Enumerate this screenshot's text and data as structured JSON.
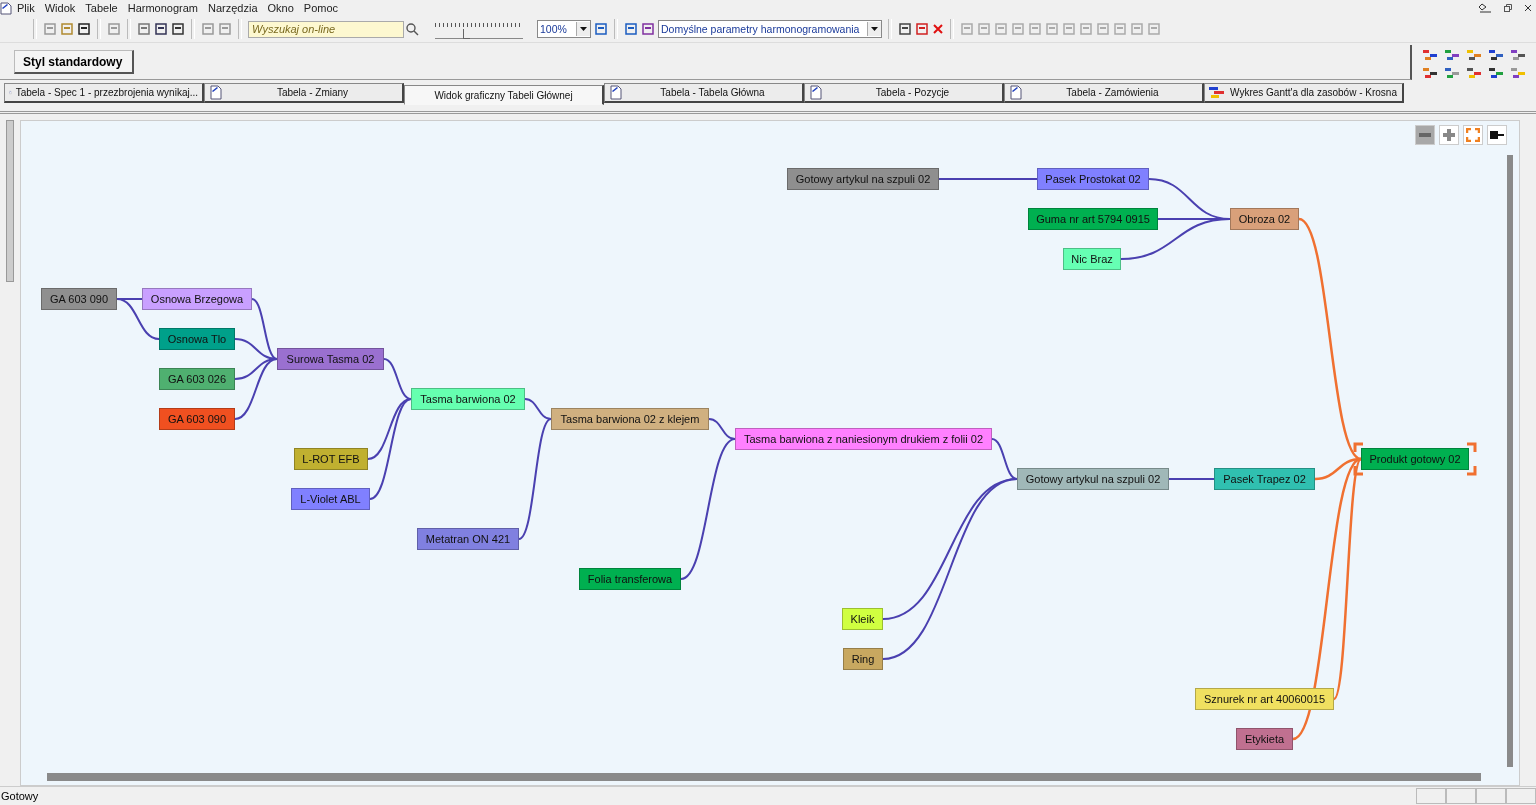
{
  "menu": [
    "Plik",
    "Widok",
    "Tabele",
    "Harmonogram",
    "Narzędzia",
    "Okno",
    "Pomoc"
  ],
  "toolbar": {
    "search": {
      "placeholder": "Wyszukaj on-line"
    },
    "zoom_slider": {
      "level": 0.35
    },
    "zoom": "100%",
    "schedule_params": "Domyślne parametry harmonogramowania"
  },
  "style_button": "Styl standardowy",
  "tabs": [
    {
      "label": "Tabela - Spec 1 - przezbrojenia wynikaj...",
      "kind": "table",
      "selected": false
    },
    {
      "label": "Tabela - Zmiany",
      "kind": "table",
      "selected": false
    },
    {
      "label": "Widok graficzny Tabeli Głównej",
      "kind": "view",
      "selected": true
    },
    {
      "label": "Tabela - Tabela Główna",
      "kind": "table",
      "selected": false
    },
    {
      "label": "Tabela - Pozycje",
      "kind": "table",
      "selected": false
    },
    {
      "label": "Tabela - Zamówienia",
      "kind": "table",
      "selected": false
    },
    {
      "label": "Wykres Gantt'a dla zasobów - Krosna",
      "kind": "gantt",
      "selected": false
    }
  ],
  "diagram": {
    "nodes": [
      {
        "label": "Gotowy artykul na szpuli 02",
        "color": "#8f8f8f",
        "selected": false
      },
      {
        "label": "Pasek Prostokat 02",
        "color": "#8080ff",
        "selected": false
      },
      {
        "label": "Guma nr art 5794 0915",
        "color": "#00b050",
        "selected": false
      },
      {
        "label": "Nic Braz",
        "color": "#66ffb3",
        "selected": false
      },
      {
        "label": "Obroza 02",
        "color": "#d9a07a",
        "selected": false
      },
      {
        "label": "GA 603 090",
        "color": "#8f8f8f",
        "selected": false
      },
      {
        "label": "Osnowa Brzegowa",
        "color": "#c9a0ff",
        "selected": false
      },
      {
        "label": "Osnowa Tlo",
        "color": "#00a08a",
        "selected": false
      },
      {
        "label": "GA 603 026",
        "color": "#4fb070",
        "selected": false
      },
      {
        "label": "GA 603 090",
        "color": "#f05020",
        "selected": false
      },
      {
        "label": "Surowa Tasma 02",
        "color": "#9a70d0",
        "selected": false
      },
      {
        "label": "Tasma barwiona 02",
        "color": "#66ffb0",
        "selected": false
      },
      {
        "label": "L-ROT EFB",
        "color": "#c0b030",
        "selected": false
      },
      {
        "label": "L-Violet ABL",
        "color": "#8080ff",
        "selected": false
      },
      {
        "label": "Metatran ON 421",
        "color": "#8080e0",
        "selected": false
      },
      {
        "label": "Tasma barwiona 02 z klejem",
        "color": "#d0b080",
        "selected": false
      },
      {
        "label": "Folia transferowa",
        "color": "#00b050",
        "selected": false
      },
      {
        "label": "Tasma barwiona z naniesionym drukiem z folii 02",
        "color": "#ff80ff",
        "selected": false
      },
      {
        "label": "Gotowy artykul na szpuli 02",
        "color": "#a0b8b8",
        "selected": false
      },
      {
        "label": "Pasek Trapez 02",
        "color": "#30c0b0",
        "selected": false
      },
      {
        "label": "Kleik",
        "color": "#d0ff40",
        "selected": false
      },
      {
        "label": "Ring",
        "color": "#c8a860",
        "selected": false
      },
      {
        "label": "Produkt gotowy 02",
        "color": "#00b050",
        "selected": true
      },
      {
        "label": "Sznurek nr art 40060015",
        "color": "#f0e060",
        "selected": false
      },
      {
        "label": "Etykieta",
        "color": "#c07090",
        "selected": false
      }
    ]
  },
  "status_bar": "Gotowy"
}
